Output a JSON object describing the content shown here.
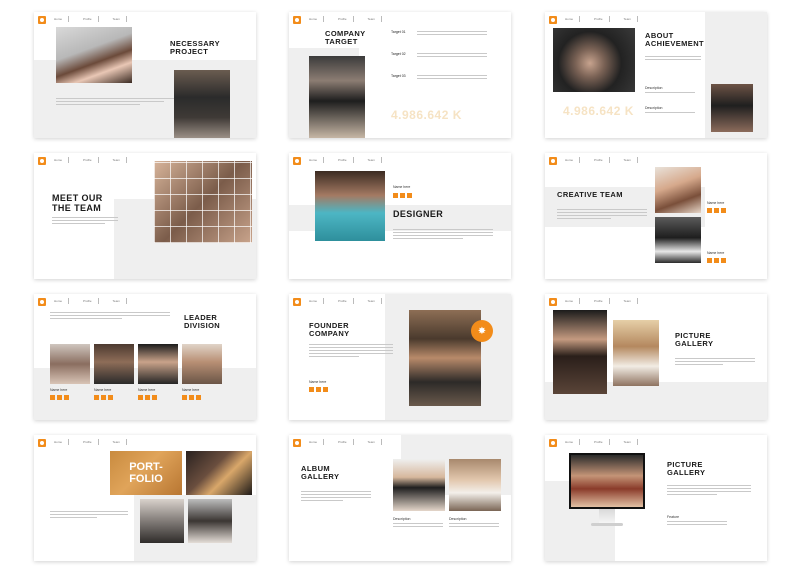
{
  "nav": [
    "Home",
    "Profile",
    "Team"
  ],
  "accent": "#f28c1a",
  "slides": {
    "necessary_project": {
      "title1": "NECESSARY",
      "title2": "PROJECT"
    },
    "company_target": {
      "title1": "COMPANY",
      "title2": "TARGET",
      "targets": [
        "Target 01",
        "Target 02",
        "Target 03"
      ],
      "number": "4.986.642 K"
    },
    "about_achievement": {
      "title1": "ABOUT",
      "title2": "ACHIEVEMENT",
      "number": "4.986.642 K",
      "desc1": "Description",
      "desc2": "Description"
    },
    "meet_team": {
      "title1": "MEET OUR",
      "title2": "THE TEAM"
    },
    "designer": {
      "title": "DESIGNER",
      "name": "Name here"
    },
    "creative_team": {
      "title": "CREATIVE TEAM",
      "name1": "Name here",
      "name2": "Name here"
    },
    "leader_division": {
      "title1": "LEADER",
      "title2": "DIVISION",
      "names": [
        "Name here",
        "Name here",
        "Name here",
        "Name here"
      ]
    },
    "founder_company": {
      "title1": "FOUNDER",
      "title2": "COMPANY",
      "name": "Name here"
    },
    "picture_gallery_1": {
      "title1": "PICTURE",
      "title2": "GALLERY"
    },
    "portfolio": {
      "title1": "PORT-",
      "title2": "FOLIO"
    },
    "album_gallery": {
      "title1": "ALBUM",
      "title2": "GALLERY",
      "desc1": "Description",
      "desc2": "Description"
    },
    "picture_gallery_2": {
      "title1": "PICTURE",
      "title2": "GALLERY",
      "feature": "Feature"
    }
  }
}
